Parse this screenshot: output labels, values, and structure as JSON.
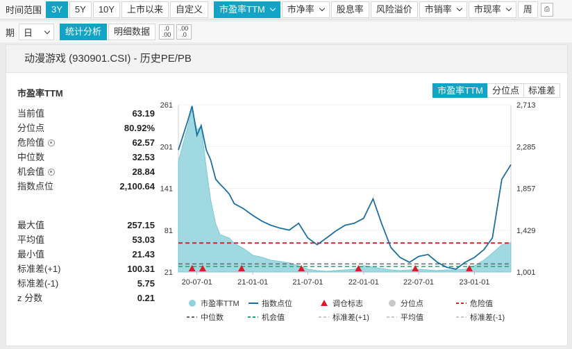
{
  "toolbar": {
    "range_label": "时间范围",
    "ranges": [
      "3Y",
      "5Y",
      "10Y",
      "上市以来",
      "自定义"
    ],
    "active_range": "3Y",
    "metric_tabs": [
      {
        "label": "市盈率TTM",
        "dropdown": true,
        "active": true
      },
      {
        "label": "市净率",
        "dropdown": true,
        "active": false
      },
      {
        "label": "股息率",
        "dropdown": false,
        "active": false
      },
      {
        "label": "风险溢价",
        "dropdown": false,
        "active": false
      },
      {
        "label": "市销率",
        "dropdown": true,
        "active": false
      },
      {
        "label": "市现率",
        "dropdown": true,
        "active": false
      },
      {
        "label": "周",
        "dropdown": false,
        "active": false
      }
    ]
  },
  "toolbar2": {
    "period_label": "期",
    "period_value": "日",
    "view_tabs": [
      "统计分析",
      "明细数据"
    ],
    "active_view": "统计分析",
    "decimal_buttons": [
      [
        ".0",
        ".00"
      ],
      [
        ".00",
        ".0"
      ]
    ]
  },
  "panel": {
    "title": "动漫游戏 (930901.CSI) - 历史PE/PB",
    "section_title": "市盈率TTM",
    "mode_tabs": [
      "市盈率TTM",
      "分位点",
      "标准差"
    ],
    "active_mode": "市盈率TTM",
    "stats_top": [
      {
        "label": "当前值",
        "value": "63.19",
        "gear": false
      },
      {
        "label": "分位点",
        "value": "80.92%",
        "gear": false
      },
      {
        "label": "危险值",
        "value": "62.57",
        "gear": true
      },
      {
        "label": "中位数",
        "value": "32.53",
        "gear": false
      },
      {
        "label": "机会值",
        "value": "28.84",
        "gear": true
      },
      {
        "label": "指数点位",
        "value": "2,100.64",
        "gear": false
      }
    ],
    "stats_bottom": [
      {
        "label": "最大值",
        "value": "257.15"
      },
      {
        "label": "平均值",
        "value": "53.03"
      },
      {
        "label": "最小值",
        "value": "21.43"
      },
      {
        "label": "标准差(+1)",
        "value": "100.31"
      },
      {
        "label": "标准差(-1)",
        "value": "5.75"
      },
      {
        "label": "z 分数",
        "value": "0.21"
      }
    ]
  },
  "colors": {
    "accent": "#13a3c5",
    "pe_area": "#8fd2dc",
    "index_line": "#1b6f9e",
    "danger": "#c8262d",
    "median": "#666666",
    "opportunity": "#2aa070",
    "marker": "#e3162a"
  },
  "chart_data": {
    "type": "line",
    "x_ticks": [
      "20-07-01",
      "21-01-01",
      "21-07-01",
      "22-01-01",
      "22-07-01",
      "23-01-01"
    ],
    "x_range": [
      "2020-05-01",
      "2023-05-01"
    ],
    "y_left_ticks": [
      "261",
      "201",
      "141",
      "81",
      "21"
    ],
    "y_left_range": [
      21,
      261
    ],
    "y_right_ticks": [
      "2,713",
      "2,285",
      "1,857",
      "1,429",
      "1,001"
    ],
    "y_right_range": [
      1001,
      2713
    ],
    "reference_lines": {
      "danger": 62.57,
      "median": 32.53,
      "opportunity": 28.84
    },
    "rebalance_markers": [
      "2020-06-15",
      "2020-07-20",
      "2020-11-25",
      "2021-06-10",
      "2021-12-15",
      "2022-06-20",
      "2022-12-15"
    ],
    "series": [
      {
        "name": "市盈率TTM",
        "x": [
          "2020-05-01",
          "2020-06-01",
          "2020-06-15",
          "2020-07-01",
          "2020-07-15",
          "2020-08-01",
          "2020-08-15",
          "2020-09-01",
          "2020-09-15",
          "2020-10-01",
          "2020-10-15",
          "2020-11-01",
          "2020-12-01",
          "2021-01-01",
          "2021-02-01",
          "2021-03-01",
          "2021-04-01",
          "2021-05-01",
          "2021-06-01",
          "2021-07-01",
          "2021-08-01",
          "2021-09-01",
          "2021-10-01",
          "2021-11-01",
          "2021-12-01",
          "2022-01-01",
          "2022-02-01",
          "2022-03-01",
          "2022-04-01",
          "2022-05-01",
          "2022-06-01",
          "2022-07-01",
          "2022-08-01",
          "2022-09-01",
          "2022-10-01",
          "2022-11-01",
          "2022-12-01",
          "2023-01-01",
          "2023-02-01",
          "2023-03-01",
          "2023-04-01",
          "2023-05-01"
        ],
        "values": [
          180,
          230,
          255,
          225,
          230,
          170,
          125,
          90,
          75,
          72,
          70,
          62,
          55,
          45,
          42,
          38,
          36,
          34,
          30,
          25,
          23,
          22,
          23,
          24,
          25,
          30,
          28,
          26,
          24,
          23,
          24,
          25,
          24,
          23,
          24,
          24,
          25,
          30,
          38,
          48,
          60,
          63
        ]
      },
      {
        "name": "指数点位",
        "x": [
          "2020-05-01",
          "2020-06-01",
          "2020-06-15",
          "2020-07-01",
          "2020-07-15",
          "2020-08-01",
          "2020-08-15",
          "2020-09-01",
          "2020-09-15",
          "2020-10-01",
          "2020-10-15",
          "2020-11-01",
          "2020-12-01",
          "2021-01-01",
          "2021-02-01",
          "2021-03-01",
          "2021-04-01",
          "2021-05-01",
          "2021-06-01",
          "2021-07-01",
          "2021-08-01",
          "2021-09-01",
          "2021-10-01",
          "2021-11-01",
          "2021-12-01",
          "2022-01-01",
          "2022-02-01",
          "2022-03-01",
          "2022-04-01",
          "2022-05-01",
          "2022-06-01",
          "2022-07-01",
          "2022-08-01",
          "2022-09-01",
          "2022-10-01",
          "2022-11-01",
          "2022-12-01",
          "2023-01-01",
          "2023-02-01",
          "2023-03-01",
          "2023-04-01",
          "2023-05-01"
        ],
        "values": [
          2250,
          2550,
          2700,
          2400,
          2500,
          2250,
          2150,
          1950,
          1900,
          1850,
          1800,
          1700,
          1650,
          1580,
          1520,
          1480,
          1450,
          1430,
          1500,
          1350,
          1280,
          1350,
          1420,
          1480,
          1500,
          1550,
          1750,
          1500,
          1250,
          1150,
          1100,
          1160,
          1180,
          1100,
          1050,
          1030,
          1100,
          1150,
          1230,
          1350,
          1950,
          2100
        ]
      }
    ],
    "legend": [
      {
        "label": "市盈率TTM",
        "kind": "circle",
        "color": "#8fd2dc",
        "muted": false
      },
      {
        "label": "指数点位",
        "kind": "line",
        "color": "#1b6f9e",
        "muted": false
      },
      {
        "label": "调仓标志",
        "kind": "triangle",
        "color": "#e3162a",
        "muted": false
      },
      {
        "label": "分位点",
        "kind": "circle",
        "color": "#c8c8c8",
        "muted": true
      },
      {
        "label": "危险值",
        "kind": "dash",
        "color": "#c8262d",
        "muted": false
      },
      {
        "label": "中位数",
        "kind": "dash",
        "color": "#666666",
        "muted": false
      },
      {
        "label": "机会值",
        "kind": "dash",
        "color": "#2aa070",
        "muted": false
      },
      {
        "label": "标准差(+1)",
        "kind": "dash",
        "color": "#c8c8c8",
        "muted": true
      },
      {
        "label": "平均值",
        "kind": "dash",
        "color": "#c8c8c8",
        "muted": true
      },
      {
        "label": "标准差(-1)",
        "kind": "dash",
        "color": "#c8c8c8",
        "muted": true
      }
    ]
  }
}
